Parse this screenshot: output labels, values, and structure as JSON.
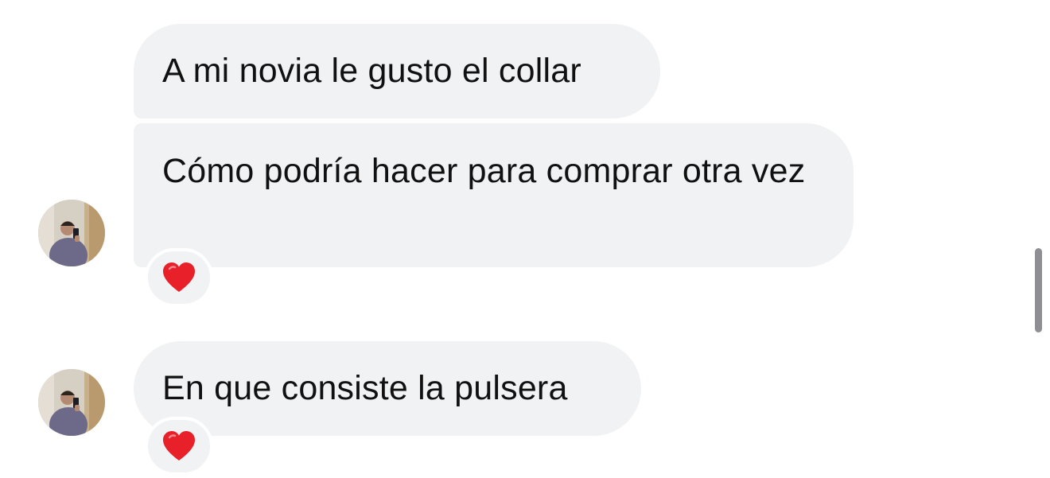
{
  "messages": [
    {
      "text": "A mi novia le gusto el collar"
    },
    {
      "text": "Cómo podría hacer para comprar otra vez",
      "reaction": "❤️"
    },
    {
      "text": "En que consiste la pulsera",
      "reaction": "❤️"
    }
  ],
  "icons": {
    "reaction": "red-heart-icon",
    "avatar": "profile-photo"
  },
  "colors": {
    "bubble": "#f1f2f4",
    "text": "#111111",
    "heart": "#e8202a",
    "scrollbar": "#8e8e93"
  }
}
